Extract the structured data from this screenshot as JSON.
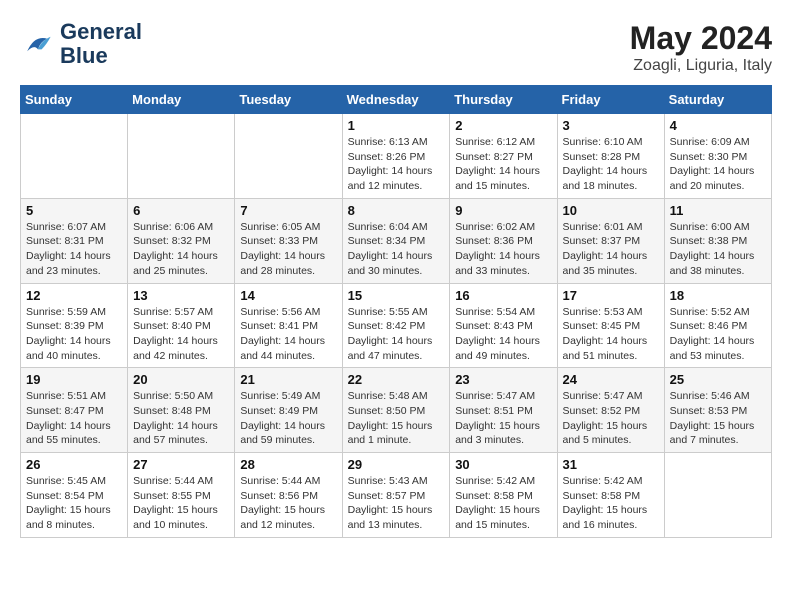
{
  "header": {
    "logo_line1": "General",
    "logo_line2": "Blue",
    "month": "May 2024",
    "location": "Zoagli, Liguria, Italy"
  },
  "days_of_week": [
    "Sunday",
    "Monday",
    "Tuesday",
    "Wednesday",
    "Thursday",
    "Friday",
    "Saturday"
  ],
  "weeks": [
    [
      {
        "day": "",
        "info": ""
      },
      {
        "day": "",
        "info": ""
      },
      {
        "day": "",
        "info": ""
      },
      {
        "day": "1",
        "sunrise": "6:13 AM",
        "sunset": "8:26 PM",
        "daylight": "14 hours and 12 minutes."
      },
      {
        "day": "2",
        "sunrise": "6:12 AM",
        "sunset": "8:27 PM",
        "daylight": "14 hours and 15 minutes."
      },
      {
        "day": "3",
        "sunrise": "6:10 AM",
        "sunset": "8:28 PM",
        "daylight": "14 hours and 18 minutes."
      },
      {
        "day": "4",
        "sunrise": "6:09 AM",
        "sunset": "8:30 PM",
        "daylight": "14 hours and 20 minutes."
      }
    ],
    [
      {
        "day": "5",
        "sunrise": "6:07 AM",
        "sunset": "8:31 PM",
        "daylight": "14 hours and 23 minutes."
      },
      {
        "day": "6",
        "sunrise": "6:06 AM",
        "sunset": "8:32 PM",
        "daylight": "14 hours and 25 minutes."
      },
      {
        "day": "7",
        "sunrise": "6:05 AM",
        "sunset": "8:33 PM",
        "daylight": "14 hours and 28 minutes."
      },
      {
        "day": "8",
        "sunrise": "6:04 AM",
        "sunset": "8:34 PM",
        "daylight": "14 hours and 30 minutes."
      },
      {
        "day": "9",
        "sunrise": "6:02 AM",
        "sunset": "8:36 PM",
        "daylight": "14 hours and 33 minutes."
      },
      {
        "day": "10",
        "sunrise": "6:01 AM",
        "sunset": "8:37 PM",
        "daylight": "14 hours and 35 minutes."
      },
      {
        "day": "11",
        "sunrise": "6:00 AM",
        "sunset": "8:38 PM",
        "daylight": "14 hours and 38 minutes."
      }
    ],
    [
      {
        "day": "12",
        "sunrise": "5:59 AM",
        "sunset": "8:39 PM",
        "daylight": "14 hours and 40 minutes."
      },
      {
        "day": "13",
        "sunrise": "5:57 AM",
        "sunset": "8:40 PM",
        "daylight": "14 hours and 42 minutes."
      },
      {
        "day": "14",
        "sunrise": "5:56 AM",
        "sunset": "8:41 PM",
        "daylight": "14 hours and 44 minutes."
      },
      {
        "day": "15",
        "sunrise": "5:55 AM",
        "sunset": "8:42 PM",
        "daylight": "14 hours and 47 minutes."
      },
      {
        "day": "16",
        "sunrise": "5:54 AM",
        "sunset": "8:43 PM",
        "daylight": "14 hours and 49 minutes."
      },
      {
        "day": "17",
        "sunrise": "5:53 AM",
        "sunset": "8:45 PM",
        "daylight": "14 hours and 51 minutes."
      },
      {
        "day": "18",
        "sunrise": "5:52 AM",
        "sunset": "8:46 PM",
        "daylight": "14 hours and 53 minutes."
      }
    ],
    [
      {
        "day": "19",
        "sunrise": "5:51 AM",
        "sunset": "8:47 PM",
        "daylight": "14 hours and 55 minutes."
      },
      {
        "day": "20",
        "sunrise": "5:50 AM",
        "sunset": "8:48 PM",
        "daylight": "14 hours and 57 minutes."
      },
      {
        "day": "21",
        "sunrise": "5:49 AM",
        "sunset": "8:49 PM",
        "daylight": "14 hours and 59 minutes."
      },
      {
        "day": "22",
        "sunrise": "5:48 AM",
        "sunset": "8:50 PM",
        "daylight": "15 hours and 1 minute."
      },
      {
        "day": "23",
        "sunrise": "5:47 AM",
        "sunset": "8:51 PM",
        "daylight": "15 hours and 3 minutes."
      },
      {
        "day": "24",
        "sunrise": "5:47 AM",
        "sunset": "8:52 PM",
        "daylight": "15 hours and 5 minutes."
      },
      {
        "day": "25",
        "sunrise": "5:46 AM",
        "sunset": "8:53 PM",
        "daylight": "15 hours and 7 minutes."
      }
    ],
    [
      {
        "day": "26",
        "sunrise": "5:45 AM",
        "sunset": "8:54 PM",
        "daylight": "15 hours and 8 minutes."
      },
      {
        "day": "27",
        "sunrise": "5:44 AM",
        "sunset": "8:55 PM",
        "daylight": "15 hours and 10 minutes."
      },
      {
        "day": "28",
        "sunrise": "5:44 AM",
        "sunset": "8:56 PM",
        "daylight": "15 hours and 12 minutes."
      },
      {
        "day": "29",
        "sunrise": "5:43 AM",
        "sunset": "8:57 PM",
        "daylight": "15 hours and 13 minutes."
      },
      {
        "day": "30",
        "sunrise": "5:42 AM",
        "sunset": "8:58 PM",
        "daylight": "15 hours and 15 minutes."
      },
      {
        "day": "31",
        "sunrise": "5:42 AM",
        "sunset": "8:58 PM",
        "daylight": "15 hours and 16 minutes."
      },
      {
        "day": "",
        "info": ""
      }
    ]
  ]
}
